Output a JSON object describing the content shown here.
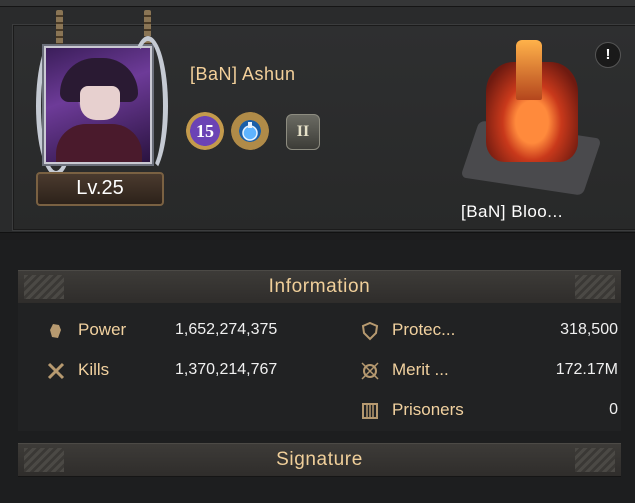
{
  "profile": {
    "name": "[BaN] Ashun",
    "level": "Lv.25",
    "badges": [
      {
        "icon": "level-15-badge",
        "text": "15"
      },
      {
        "icon": "potion-badge",
        "text": ""
      },
      {
        "icon": "rank-badge",
        "text": "II"
      }
    ]
  },
  "castle": {
    "name": "[BaN] Bloo...",
    "icon": "castle-icon"
  },
  "alert": "!",
  "information": {
    "header": "Information",
    "stats": [
      {
        "icon": "power-fist-icon",
        "label": "Power",
        "value": "1,652,274,375"
      },
      {
        "icon": "kills-swords-icon",
        "label": "Kills",
        "value": "1,370,214,767"
      },
      {
        "icon": "protection-shield-icon",
        "label": "Protec...",
        "value": "318,500"
      },
      {
        "icon": "merit-icon",
        "label": "Merit ...",
        "value": "172.17M"
      },
      {
        "icon": "prison-icon",
        "label": "Prisoners",
        "value": "0"
      }
    ]
  },
  "signature": {
    "header": "Signature"
  }
}
